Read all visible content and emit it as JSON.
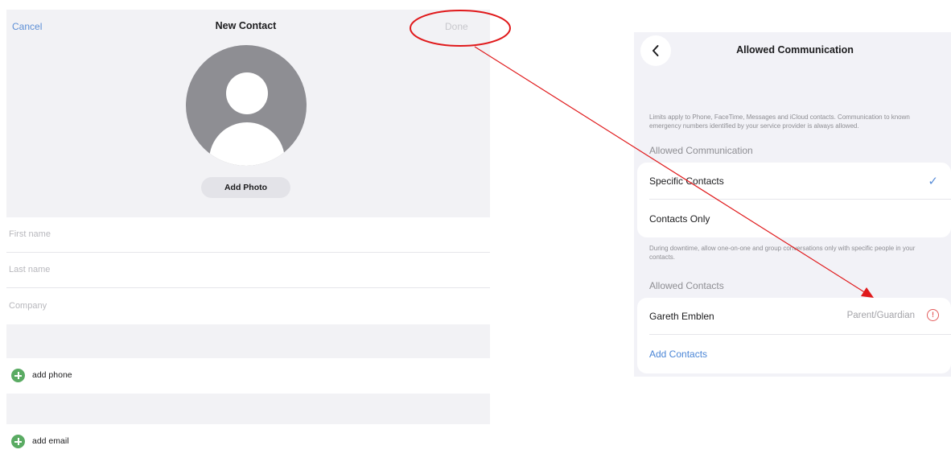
{
  "new_contact": {
    "cancel_label": "Cancel",
    "title": "New Contact",
    "done_label": "Done",
    "add_photo_label": "Add Photo",
    "fields": [
      {
        "placeholder": "First name"
      },
      {
        "placeholder": "Last name"
      },
      {
        "placeholder": "Company"
      }
    ],
    "add_phone_label": "add phone",
    "add_email_label": "add email"
  },
  "allowed_communication": {
    "title": "Allowed Communication",
    "description": "Limits apply to Phone, FaceTime, Messages and iCloud contacts. Communication to known emergency numbers identified by your service provider is always allowed.",
    "section_allowed_communication": "Allowed Communication",
    "options": [
      {
        "label": "Specific Contacts",
        "selected": true
      },
      {
        "label": "Contacts Only",
        "selected": false
      }
    ],
    "downtime_note": "During downtime, allow one-on-one and group conversations only with specific people in your contacts.",
    "section_allowed_contacts": "Allowed Contacts",
    "contacts": [
      {
        "name": "Gareth Emblen",
        "role": "Parent/Guardian",
        "icon": "info-circle-icon"
      }
    ],
    "add_contacts_label": "Add Contacts",
    "check_glyph": "✓",
    "info_glyph": "!"
  },
  "annotation": {
    "color": "#e0191b",
    "type": "circle-and-arrow",
    "from": "done-button",
    "to": "info-circle-icon"
  }
}
